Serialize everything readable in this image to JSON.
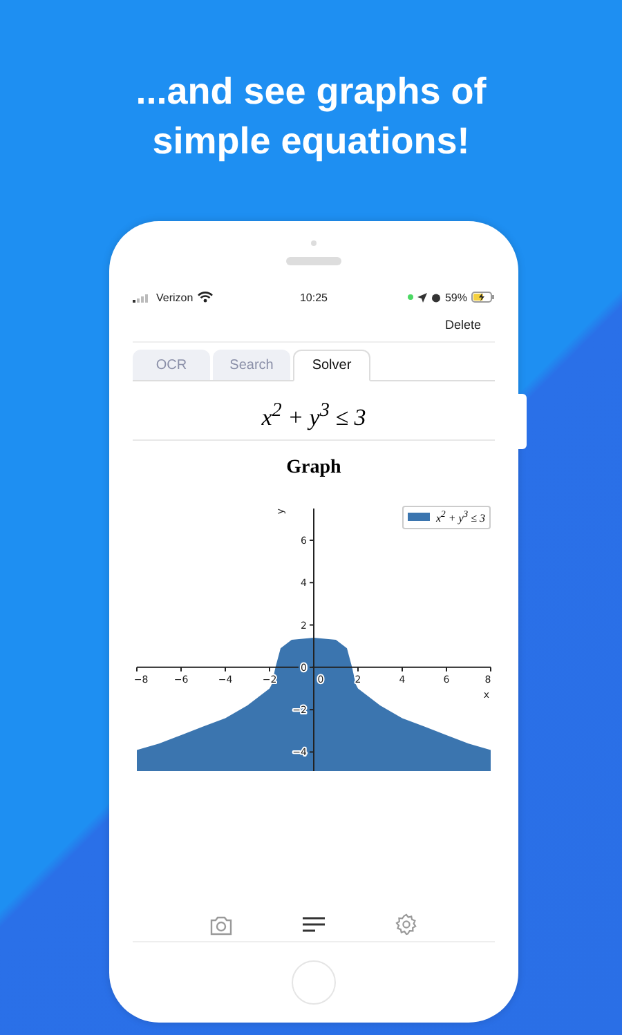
{
  "headline": "...and see graphs of simple equations!",
  "status_bar": {
    "carrier": "Verizon",
    "time": "10:25",
    "battery": "59%"
  },
  "toolbar": {
    "action": "Delete"
  },
  "tabs": [
    {
      "label": "OCR",
      "selected": false
    },
    {
      "label": "Search",
      "selected": false
    },
    {
      "label": "Solver",
      "selected": true
    }
  ],
  "equation": "x$^{2}$ + y$^{3}$ ≤ 3",
  "graph": {
    "title": "Graph",
    "chart_data": {
      "type": "area",
      "xlabel": "x",
      "ylabel": "y",
      "x": [
        -8,
        -7,
        -6,
        -5,
        -4,
        -3,
        -2,
        -1.9,
        -1.732,
        -1.5,
        -1,
        0,
        1,
        1.5,
        1.732,
        1.9,
        2,
        3,
        4,
        5,
        6,
        7,
        8
      ],
      "series": [
        {
          "name": "x$^{2}$ + y$^{3}$ ≤ 3",
          "color": "#3b75af",
          "values": [
            -3.9,
            -3.6,
            -3.2,
            -2.8,
            -2.4,
            -1.8,
            -1,
            -0.8,
            0,
            0.9,
            1.3,
            1.4,
            1.3,
            0.9,
            0,
            -0.8,
            -1,
            -1.8,
            -2.4,
            -2.8,
            -3.2,
            -3.6,
            -3.9
          ]
        }
      ],
      "xlim": [
        -8,
        8
      ],
      "ylim": [
        -4.9,
        7.5
      ],
      "xticks": [
        -8,
        -6,
        -4,
        -2,
        0,
        2,
        4,
        6,
        8
      ],
      "yticks": [
        -4,
        -2,
        0,
        2,
        4,
        6
      ]
    }
  },
  "bottom_nav": [
    {
      "kind": "camera",
      "selected": false
    },
    {
      "kind": "list",
      "selected": true
    },
    {
      "kind": "settings",
      "selected": false
    }
  ]
}
